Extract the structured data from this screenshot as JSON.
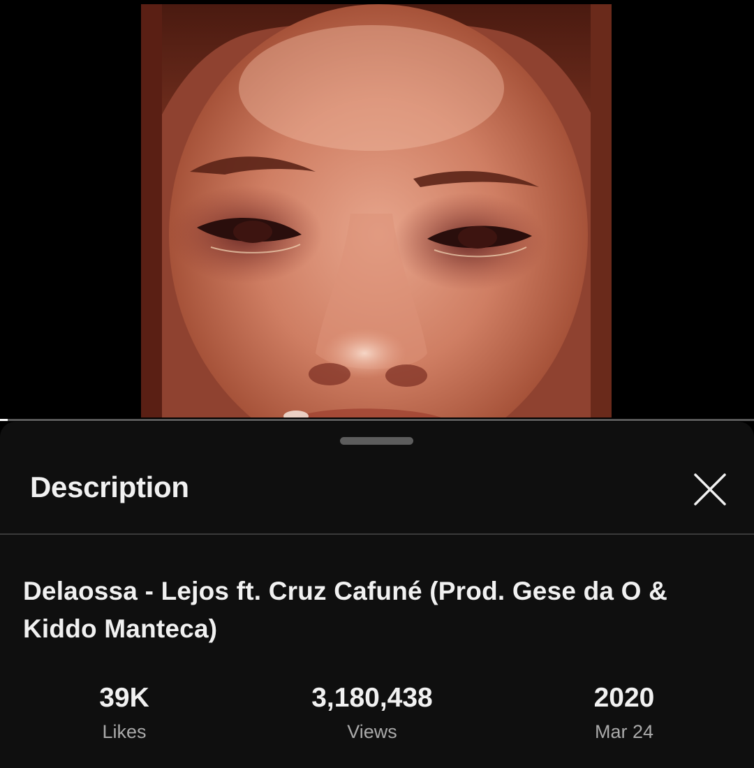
{
  "player": {
    "progress": 0.01
  },
  "sheet": {
    "title": "Description",
    "close_icon": "close-icon"
  },
  "video": {
    "title": "Delaossa - Lejos ft. Cruz Cafuné (Prod. Gese da O & Kiddo Manteca)"
  },
  "stats": {
    "likes_value": "39K",
    "likes_label": "Likes",
    "views_value": "3,180,438",
    "views_label": "Views",
    "year_value": "2020",
    "date_label": "Mar 24"
  },
  "colors": {
    "sheet_background": "#0f0f0f",
    "text_primary": "#f1f1f1",
    "text_secondary": "#aaaaaa",
    "divider": "#3a3a3a"
  }
}
